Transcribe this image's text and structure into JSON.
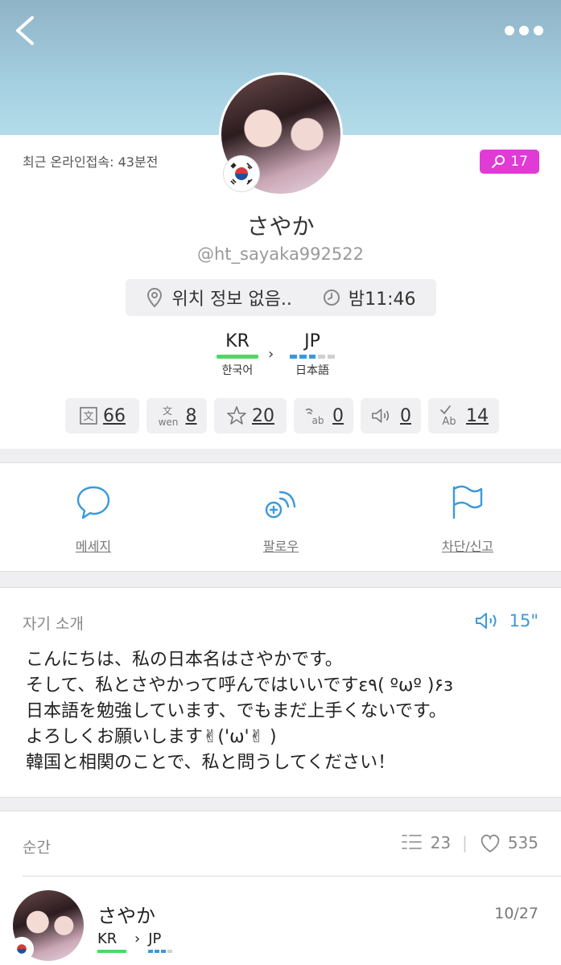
{
  "header": {
    "back_icon": "chevron-left-icon",
    "more_icon": "more-dots-icon"
  },
  "profile": {
    "last_online": "최근 온라인접속: 43분전",
    "pin_count": "17",
    "name": "さやか",
    "handle": "@ht_sayaka992522",
    "location": "위치 정보 없음..",
    "local_time": "밤11:46",
    "native_lang": {
      "code": "KR",
      "name": "한국어"
    },
    "learning_lang": {
      "code": "JP",
      "name": "日本語"
    },
    "stats": [
      {
        "icon": "translate-icon",
        "value": "66"
      },
      {
        "icon": "transliterate-icon",
        "value": "8"
      },
      {
        "icon": "star-icon",
        "value": "20"
      },
      {
        "icon": "speech-to-text-icon",
        "value": "0"
      },
      {
        "icon": "speaker-icon",
        "value": "0"
      },
      {
        "icon": "correction-icon",
        "value": "14"
      }
    ]
  },
  "actions": {
    "message": "메세지",
    "follow": "팔로우",
    "block": "차단/신고"
  },
  "intro": {
    "title": "자기 소개",
    "audio_length": "15\"",
    "text": "こんにちは、私の日本名はさやかです。\nそして、私とさやかって呼んではいいですε٩( ºωº )۶з\n日本語を勉強しています、でもまだ上手くないです。\nよろしくお願いします✌('ω'✌ )\n韓国と相関のことで、私と問うしてください！"
  },
  "moments": {
    "title": "순간",
    "comment_count": "23",
    "like_count": "535",
    "post": {
      "name": "さやか",
      "date": "10/27",
      "from": "KR",
      "to": "JP"
    }
  },
  "colors": {
    "accent": "#3a9ad9",
    "badge": "#e03bd6",
    "native_bar": "#4cd964",
    "learning_bar": "#3a9ad9"
  }
}
